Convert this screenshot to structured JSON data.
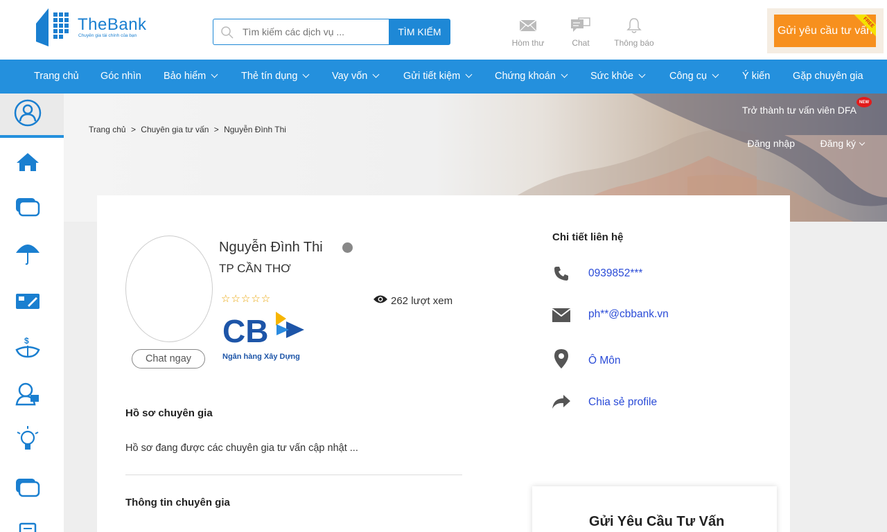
{
  "header": {
    "logo_text": "TheBank",
    "logo_subtitle": "Chuyên gia tài chính của bạn",
    "search_placeholder": "Tìm kiếm các dịch vụ ...",
    "search_button": "TÌM KIẾM",
    "icons": [
      {
        "label": "Hòm thư",
        "icon": "mail-icon"
      },
      {
        "label": "Chat",
        "icon": "chat-icon"
      },
      {
        "label": "Thông báo",
        "icon": "bell-icon"
      }
    ],
    "cta_label": "Gửi yêu cầu tư vấn",
    "cta_ribbon": "FREE"
  },
  "nav": {
    "items": [
      {
        "label": "Trang chủ",
        "dropdown": false
      },
      {
        "label": "Góc nhìn",
        "dropdown": false
      },
      {
        "label": "Bảo hiểm",
        "dropdown": true
      },
      {
        "label": "Thẻ tín dụng",
        "dropdown": true
      },
      {
        "label": "Vay vốn",
        "dropdown": true
      },
      {
        "label": "Gửi tiết kiệm",
        "dropdown": true
      },
      {
        "label": "Chứng khoán",
        "dropdown": true
      },
      {
        "label": "Sức khỏe",
        "dropdown": true
      },
      {
        "label": "Công cụ",
        "dropdown": true
      },
      {
        "label": "Ý kiến",
        "dropdown": false
      },
      {
        "label": "Gặp chuyên gia",
        "dropdown": false
      }
    ]
  },
  "sidebar": {
    "icons": [
      "user-circle-icon",
      "home-icon",
      "card-icon",
      "umbrella-icon",
      "credit-card-icon",
      "money-hand-icon",
      "consultant-icon",
      "lightbulb-icon",
      "card-icon",
      "document-icon"
    ]
  },
  "banner": {
    "breadcrumb": [
      "Trang chủ",
      ">",
      "Chuyên gia tư vấn",
      ">",
      "Nguyễn Đình Thi"
    ],
    "dfa_link": "Trở thành tư vấn viên DFA",
    "new_badge": "NEW",
    "login": "Đăng nhập",
    "register": "Đăng ký"
  },
  "expert": {
    "name": "Nguyễn Đình Thi",
    "city": "TP CẦN THƠ",
    "rating_stars": 0,
    "rating_max": 5,
    "views": "262 lượt xem",
    "chat_button": "Chat ngay",
    "bank_name": "Ngân hàng Xây Dựng",
    "bank_abbr": "CB"
  },
  "profile": {
    "title": "Hồ sơ chuyên gia",
    "text": "Hồ sơ đang được các chuyên gia tư vấn cập nhật ...",
    "info_title": "Thông tin chuyên gia"
  },
  "contact": {
    "title": "Chi tiết liên hệ",
    "phone": "0939852***",
    "email": "ph**@cbbank.vn",
    "location": "Ô Môn",
    "share": "Chia sẻ profile"
  },
  "request": {
    "title": "Gửi Yêu Cầu Tư Vấn"
  },
  "colors": {
    "brand_blue": "#2490dd",
    "cta_orange": "#f7901e",
    "link_blue": "#2a4bd7",
    "star_gold": "#e8a200"
  }
}
